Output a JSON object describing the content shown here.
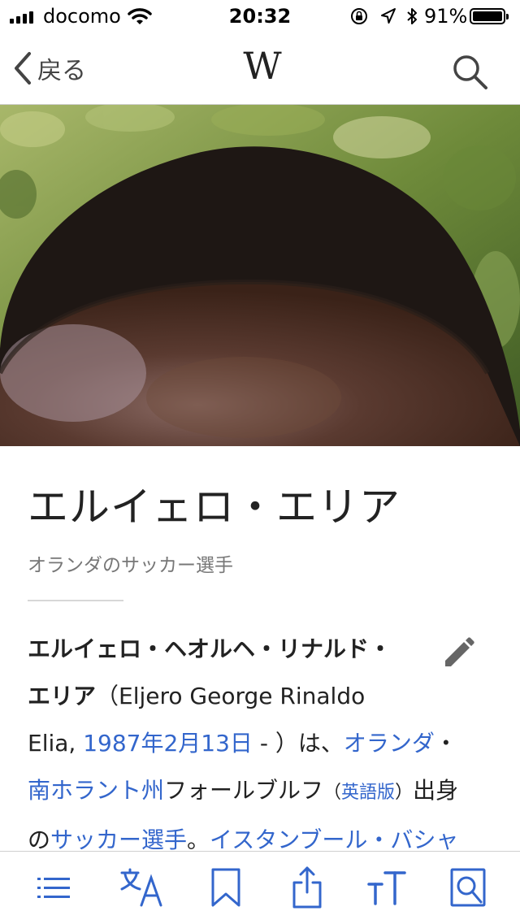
{
  "status_bar": {
    "carrier": "docomo",
    "time": "20:32",
    "battery_percent": "91%"
  },
  "nav": {
    "back_label": "戻る",
    "logo": "W"
  },
  "article": {
    "title": "エルイェロ・エリア",
    "subtitle": "オランダのサッカー選手",
    "lines": {
      "l1_bold": "エルイェロ・ヘオルヘ・リナルド・",
      "l2_bold": "エリア",
      "l2_rest": "（Eljero George Rinaldo",
      "l3_a": "Elia, ",
      "l3_link_date": "1987年2月13日",
      "l3_b": " - ）は、",
      "l3_link_country": "オランダ",
      "l3_c": "・",
      "l4_link_province": "南ホラント州",
      "l4_a": "フォールブルフ",
      "l4_paren_open": "（",
      "l4_link_english": "英語版",
      "l4_paren_close": "）",
      "l4_b": "出身",
      "l5_a": "の",
      "l5_link_player": "サッカー選手",
      "l5_b": "。",
      "l5_link_club": "イスタンブール・バシャ"
    }
  },
  "colors": {
    "link": "#3366cc",
    "toolbar_icon": "#3366cc"
  },
  "toolbar_icons": [
    "contents-icon",
    "language-icon",
    "bookmark-icon",
    "share-icon",
    "text-size-icon",
    "find-in-page-icon"
  ]
}
